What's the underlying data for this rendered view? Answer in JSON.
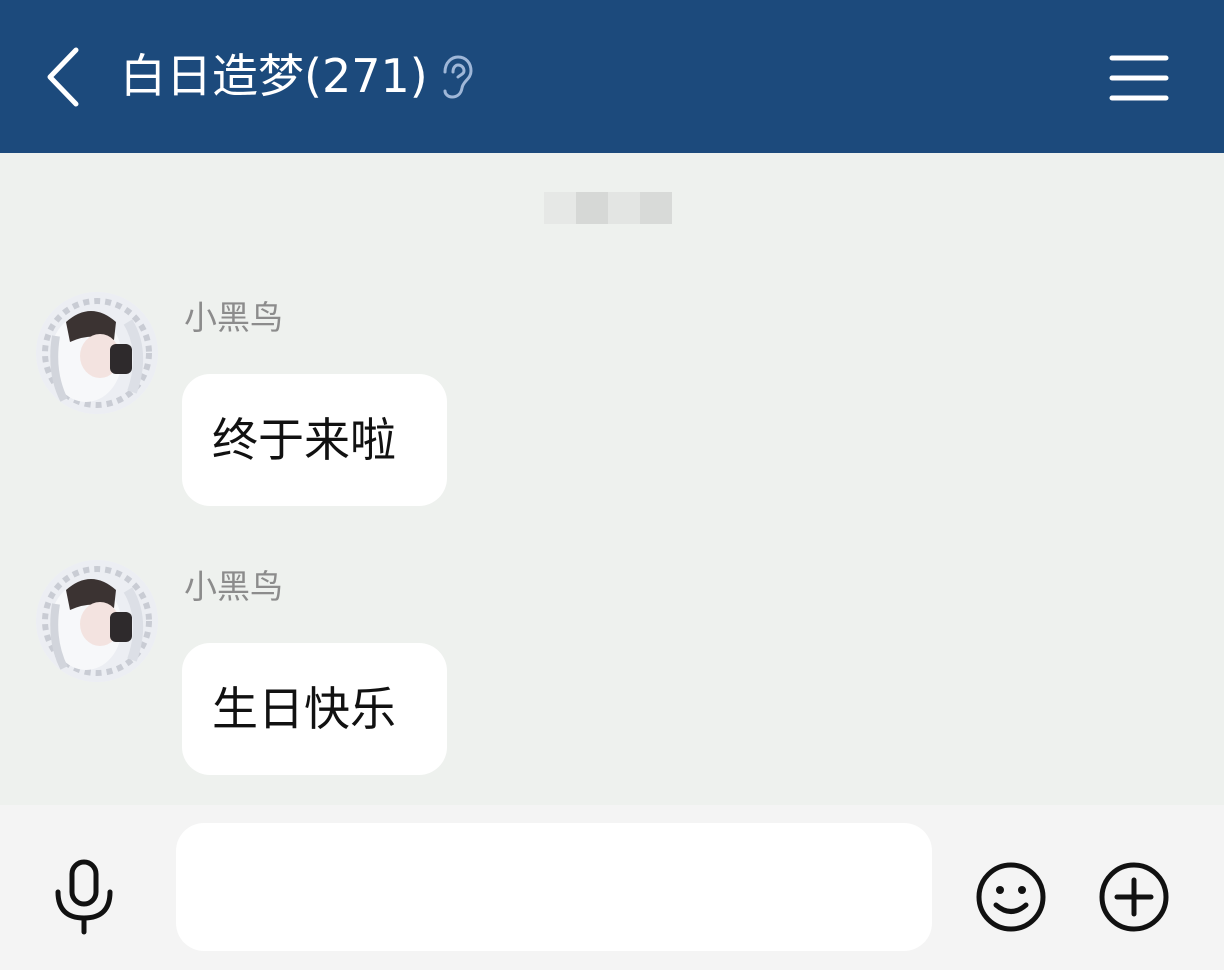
{
  "header": {
    "title": "白日造梦(271)",
    "icons": {
      "back": "chevron-left-icon",
      "listen": "ear-icon",
      "menu": "hamburger-menu-icon"
    },
    "background_color": "#1c4a7c"
  },
  "timestamp": {
    "text": ""
  },
  "messages": [
    {
      "sender": "小黑鸟",
      "text": "终于来啦"
    },
    {
      "sender": "小黑鸟",
      "text": "生日快乐"
    }
  ],
  "input_bar": {
    "placeholder": "",
    "value": "",
    "icons": {
      "voice": "microphone-icon",
      "emoji": "smiley-face-icon",
      "more": "plus-circle-icon"
    }
  }
}
